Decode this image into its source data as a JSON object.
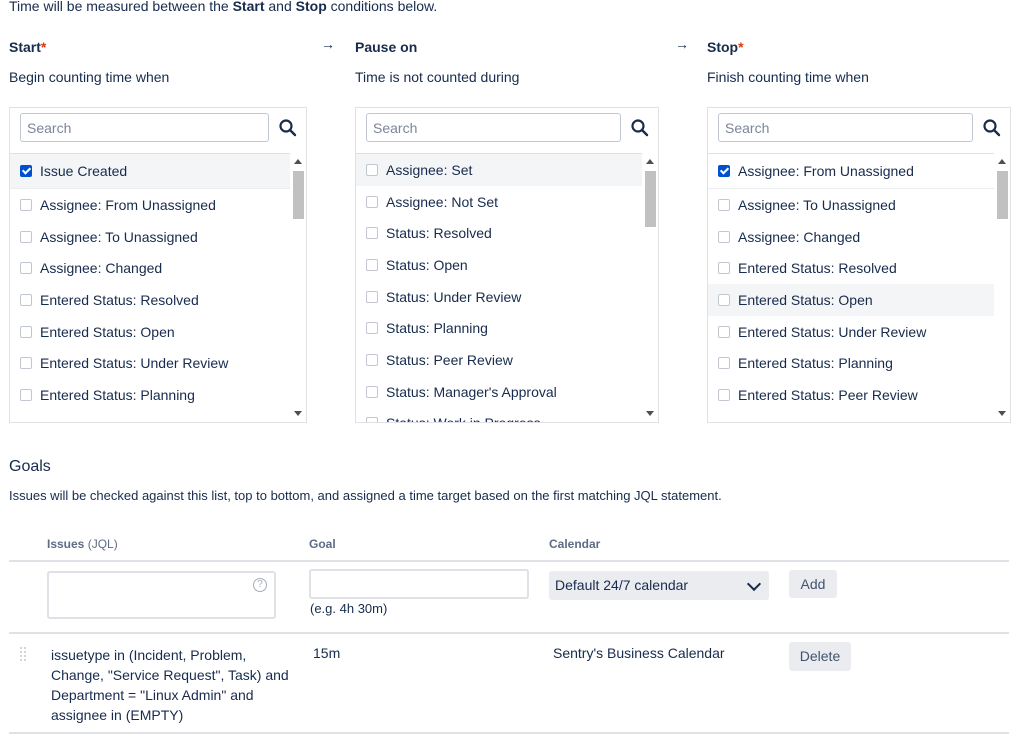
{
  "intro": {
    "prefix": "Time will be measured between the ",
    "start_word": "Start",
    "middle": " and ",
    "stop_word": "Stop",
    "suffix": " conditions below."
  },
  "columns": [
    {
      "title": "Start",
      "required": true,
      "subtitle": "Begin counting time when",
      "search_placeholder": "Search",
      "items": [
        {
          "label": "Issue Created",
          "checked": true
        },
        {
          "label": "Assignee: From Unassigned",
          "checked": false
        },
        {
          "label": "Assignee: To Unassigned",
          "checked": false
        },
        {
          "label": "Assignee: Changed",
          "checked": false
        },
        {
          "label": "Entered Status: Resolved",
          "checked": false
        },
        {
          "label": "Entered Status: Open",
          "checked": false
        },
        {
          "label": "Entered Status: Under Review",
          "checked": false
        },
        {
          "label": "Entered Status: Planning",
          "checked": false
        }
      ]
    },
    {
      "title": "Pause on",
      "required": false,
      "subtitle": "Time is not counted during",
      "search_placeholder": "Search",
      "items": [
        {
          "label": "Assignee: Set",
          "checked": false
        },
        {
          "label": "Assignee: Not Set",
          "checked": false
        },
        {
          "label": "Status: Resolved",
          "checked": false
        },
        {
          "label": "Status: Open",
          "checked": false
        },
        {
          "label": "Status: Under Review",
          "checked": false
        },
        {
          "label": "Status: Planning",
          "checked": false
        },
        {
          "label": "Status: Peer Review",
          "checked": false
        },
        {
          "label": "Status: Manager's Approval",
          "checked": false
        },
        {
          "label": "Status: Work in Progress",
          "checked": false
        }
      ]
    },
    {
      "title": "Stop",
      "required": true,
      "subtitle": "Finish counting time when",
      "search_placeholder": "Search",
      "items": [
        {
          "label": "Assignee: From Unassigned",
          "checked": true
        },
        {
          "label": "Assignee: To Unassigned",
          "checked": false
        },
        {
          "label": "Assignee: Changed",
          "checked": false
        },
        {
          "label": "Entered Status: Resolved",
          "checked": false
        },
        {
          "label": "Entered Status: Open",
          "checked": false
        },
        {
          "label": "Entered Status: Under Review",
          "checked": false
        },
        {
          "label": "Entered Status: Planning",
          "checked": false
        },
        {
          "label": "Entered Status: Peer Review",
          "checked": false
        }
      ]
    }
  ],
  "arrow_glyph": "→",
  "required_mark": "*",
  "goals": {
    "title": "Goals",
    "description": "Issues will be checked against this list, top to bottom, and assigned a time target based on the first matching JQL statement.",
    "headers": {
      "issues": "Issues",
      "issues_suffix": "(JQL)",
      "goal": "Goal",
      "calendar": "Calendar"
    },
    "new_row": {
      "jql_value": "",
      "goal_value": "",
      "goal_hint": "(e.g. 4h 30m)",
      "calendar_selected": "Default 24/7 calendar",
      "add_label": "Add"
    },
    "rows": [
      {
        "jql": "issuetype in (Incident, Problem, Change, \"Service Request\", Task) and Department = \"Linux Admin\" and assignee in (EMPTY)",
        "goal": "15m",
        "calendar": "Sentry's Business Calendar",
        "delete_label": "Delete"
      }
    ]
  },
  "colors": {
    "accent": "#0052cc",
    "required": "#de350b",
    "border": "#dfe1e6",
    "button_bg": "#ebecf0"
  }
}
